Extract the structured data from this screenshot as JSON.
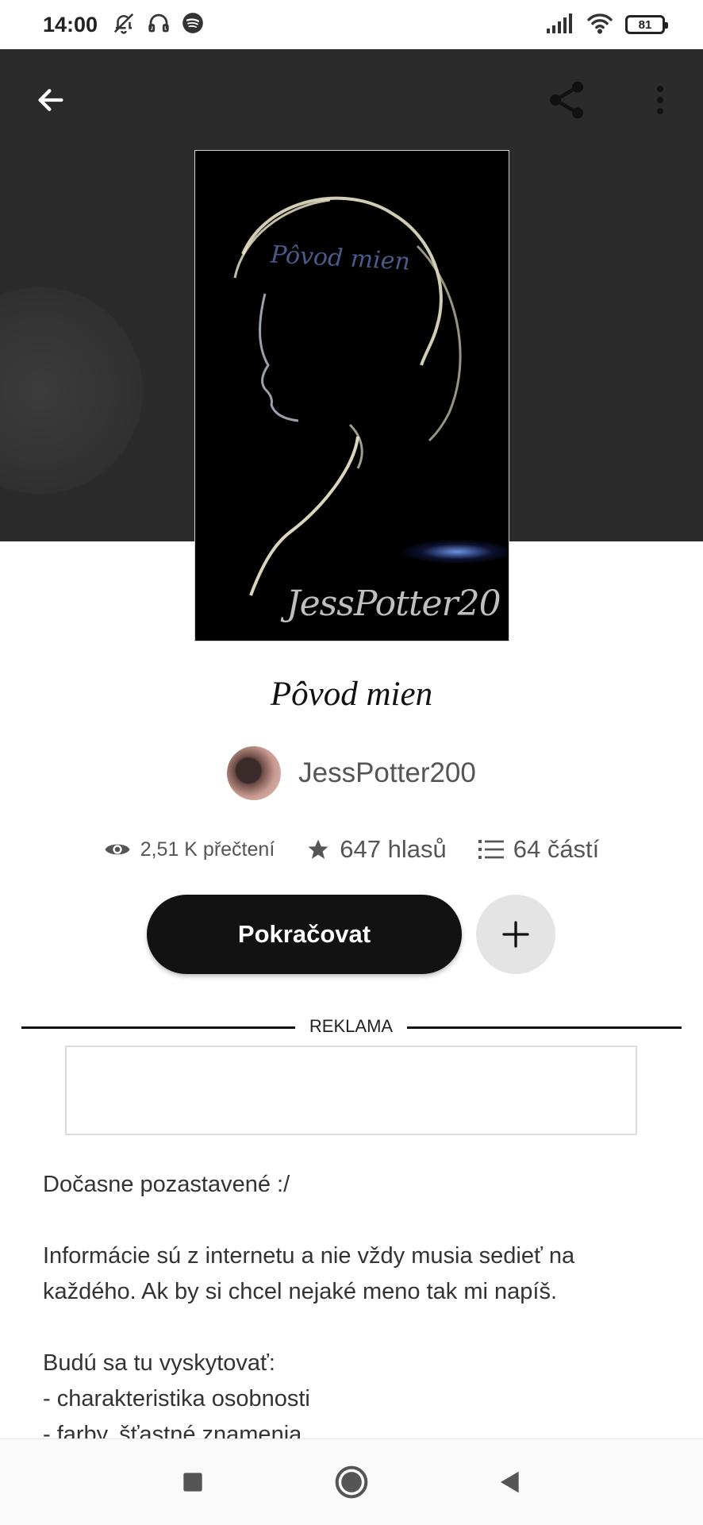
{
  "status_bar": {
    "time": "14:00",
    "left_icons": [
      "bell-off-icon",
      "headphones-icon",
      "spotify-icon"
    ],
    "right_icons": [
      "signal-icon",
      "wifi-icon"
    ],
    "battery": "81"
  },
  "header": {
    "back_icon": "arrow-left-icon",
    "share_icon": "share-icon",
    "more_icon": "more-vertical-icon"
  },
  "cover": {
    "title_text": "Pôvod mien",
    "author_text": "JessPotter20"
  },
  "book": {
    "title": "Pôvod mien",
    "author": "JessPotter200"
  },
  "stats": {
    "reads": "2,51 K přečtení",
    "votes": "647 hlasů",
    "parts": "64 částí"
  },
  "actions": {
    "continue_label": "Pokračovat",
    "add_icon": "plus-icon"
  },
  "ad": {
    "label": "REKLAMA"
  },
  "description": "Dočasne pozastavené :/\n\nInformácie sú z internetu a nie vždy musia sedieť na každého. Ak by si chcel nejaké meno tak mi napíš.\n\nBudú sa tu vyskytovať:\n- charakteristika osobnosti\n- farby, šťastné znamenia",
  "navbar": {
    "icons": [
      "recents-square-icon",
      "home-circle-icon",
      "back-triangle-icon"
    ]
  },
  "colors": {
    "header_bg": "#2b2b2b",
    "button_dark": "#121212",
    "button_light": "#e4e4e4"
  }
}
